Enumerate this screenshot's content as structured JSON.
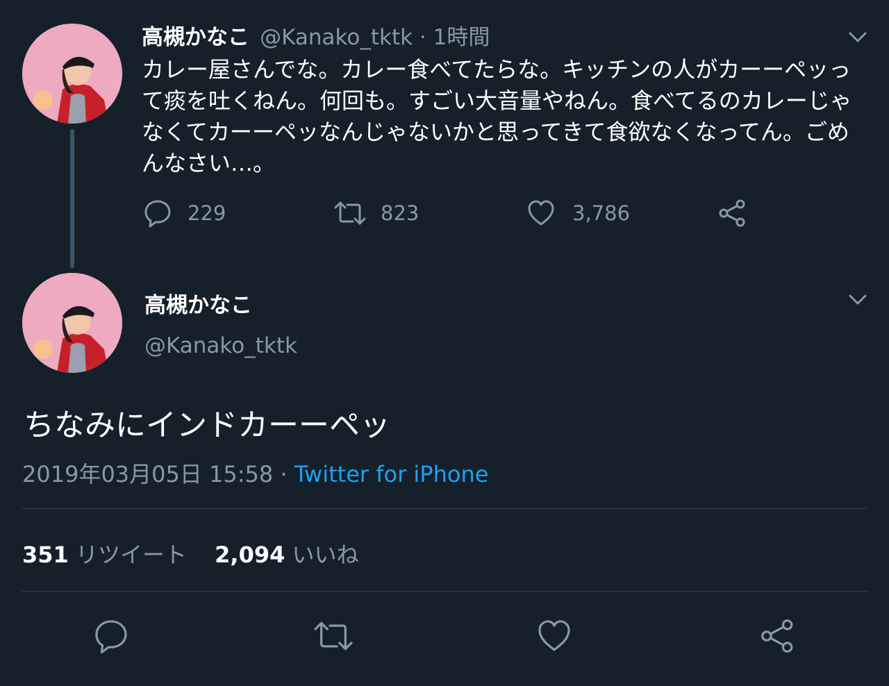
{
  "colors": {
    "background": "#15202b",
    "muted": "#8899a6",
    "accent": "#1da1f2",
    "divider": "#38444d"
  },
  "reply_tweet": {
    "author_name": "高槻かなこ",
    "handle": "@Kanako_tktk",
    "time": " · 1時間",
    "text": "カレー屋さんでな。カレー食べてたらな。キッチンの人がカーーペッって痰を吐くねん。何回も。すごい大音量やねん。食べてるのカレーじゃなくてカーーペッなんじゃないかと思ってきて食欲なくなってん。ごめんなさい…。",
    "actions": [
      {
        "icon": "reply-icon",
        "count": "229"
      },
      {
        "icon": "retweet-icon",
        "count": "823"
      },
      {
        "icon": "like-icon",
        "count": "3,786"
      },
      {
        "icon": "share-icon",
        "count": ""
      }
    ]
  },
  "main_tweet": {
    "author_name": "高槻かなこ",
    "handle": "@Kanako_tktk",
    "text": "ちなみにインドカーーペッ",
    "timestamp": "2019年03月05日 15:58",
    "separator": " · ",
    "source": "Twitter for iPhone",
    "retweet_count": "351",
    "retweet_label": "リツイート",
    "like_count": "2,094",
    "like_label": "いいね"
  },
  "action_bar": [
    "reply-icon",
    "retweet-icon",
    "like-icon",
    "share-icon"
  ]
}
